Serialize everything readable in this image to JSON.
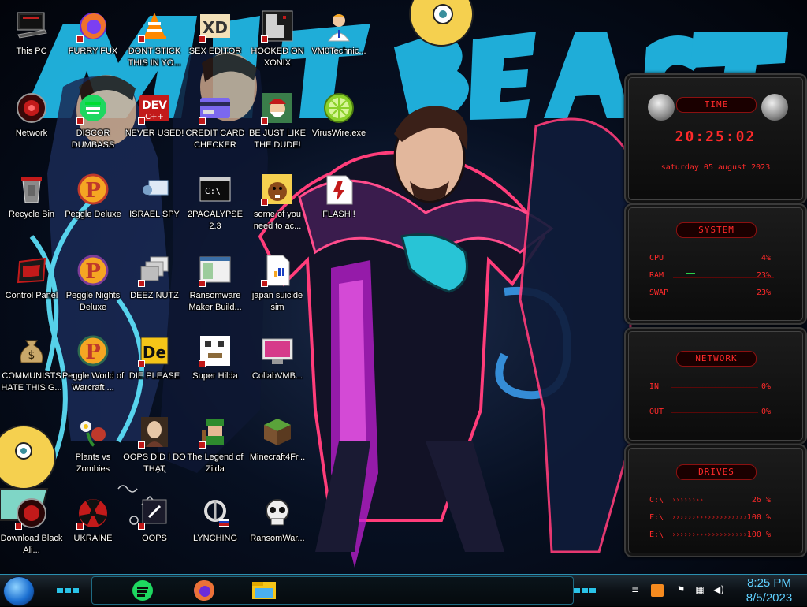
{
  "desktop": {
    "icons": [
      {
        "label": "This PC",
        "icon": "computer-icon"
      },
      {
        "label": "FURRY FUX",
        "icon": "firefox-icon"
      },
      {
        "label": "DONT STICK THIS IN YO...",
        "icon": "vlc-icon"
      },
      {
        "label": "SEX EDITOR",
        "icon": "xd-icon"
      },
      {
        "label": "HOOKED ON XONIX",
        "icon": "xonix-icon"
      },
      {
        "label": "VM0Technic...",
        "icon": "technician-icon"
      },
      {
        "label": "Network",
        "icon": "network-icon"
      },
      {
        "label": "DISCOR DUMBASS",
        "icon": "discord-icon"
      },
      {
        "label": "NEVER USED!",
        "icon": "dev-icon"
      },
      {
        "label": "CREDIT CARD CHECKER",
        "icon": "credit-card-icon"
      },
      {
        "label": "BE JUST LIKE THE DUDE!",
        "icon": "santa-icon"
      },
      {
        "label": "VirusWire.exe",
        "icon": "lime-icon"
      },
      {
        "label": "Recycle Bin",
        "icon": "recycle-bin-icon"
      },
      {
        "label": "Peggle Deluxe",
        "icon": "peggle-icon"
      },
      {
        "label": "ISRAEL SPY",
        "icon": "spy-icon"
      },
      {
        "label": "2PACALYPSE 2.3",
        "icon": "console-icon"
      },
      {
        "label": "some of you need to ac...",
        "icon": "beaver-icon"
      },
      {
        "label": "FLASH !",
        "icon": "flash-icon"
      },
      {
        "label": "Control Panel",
        "icon": "control-panel-icon"
      },
      {
        "label": "Peggle Nights Deluxe",
        "icon": "peggle-nights-icon"
      },
      {
        "label": "DEEZ NUTZ",
        "icon": "windows-stack-icon"
      },
      {
        "label": "Ransomware Maker Build...",
        "icon": "ransomware-maker-icon"
      },
      {
        "label": "japan suicide sim",
        "icon": "document-icon"
      },
      {
        "label": "COMMUNISTS HATE THIS G...",
        "icon": "money-bag-icon"
      },
      {
        "label": "Peggle World of Warcraft ...",
        "icon": "peggle-wow-icon"
      },
      {
        "label": "DIE PLEASE",
        "icon": "de-icon"
      },
      {
        "label": "Super Hilda",
        "icon": "pixel-hilda-icon"
      },
      {
        "label": "CollabVMB...",
        "icon": "collabvm-icon"
      },
      {
        "label": "Plants vs Zombies",
        "icon": "plants-icon"
      },
      {
        "label": "OOPS DID I DO THAT",
        "icon": "portrait-icon"
      },
      {
        "label": "The Legend of Zilda",
        "icon": "zilda-icon"
      },
      {
        "label": "Minecraft4Fr...",
        "icon": "minecraft-icon"
      },
      {
        "label": "Download Black Ali...",
        "icon": "alienware-icon"
      },
      {
        "label": "UKRAINE",
        "icon": "radiation-icon"
      },
      {
        "label": "OOPS",
        "icon": "oops-icon"
      },
      {
        "label": "LYNCHING",
        "icon": "lynching-icon"
      },
      {
        "label": "RansomWar...",
        "icon": "skull-icon"
      }
    ]
  },
  "gadgets": {
    "time": {
      "title": "TIME",
      "clock": "20:25:02",
      "date": "saturday 05 august 2023"
    },
    "system": {
      "title": "SYSTEM",
      "rows": [
        {
          "label": "CPU",
          "value": "4%"
        },
        {
          "label": "RAM",
          "value": "23%"
        },
        {
          "label": "SWAP",
          "value": "23%"
        }
      ]
    },
    "network": {
      "title": "NETWORK",
      "rows": [
        {
          "label": "IN",
          "value": "0%"
        },
        {
          "label": "OUT",
          "value": "0%"
        }
      ]
    },
    "drives": {
      "title": "DRIVES",
      "rows": [
        {
          "label": "C:\\",
          "value": "26 %"
        },
        {
          "label": "F:\\",
          "value": "100 %"
        },
        {
          "label": "E:\\",
          "value": "100 %"
        }
      ]
    }
  },
  "taskbar": {
    "pinned": [
      "spotify-icon",
      "firefox-icon",
      "file-explorer-icon"
    ],
    "clock_time": "8:25 PM",
    "clock_date": "8/5/2023"
  },
  "colors": {
    "gadget_red": "#ff2a2a",
    "clock_blue": "#5fd0ff",
    "accent_cyan": "#2ac3e8"
  }
}
